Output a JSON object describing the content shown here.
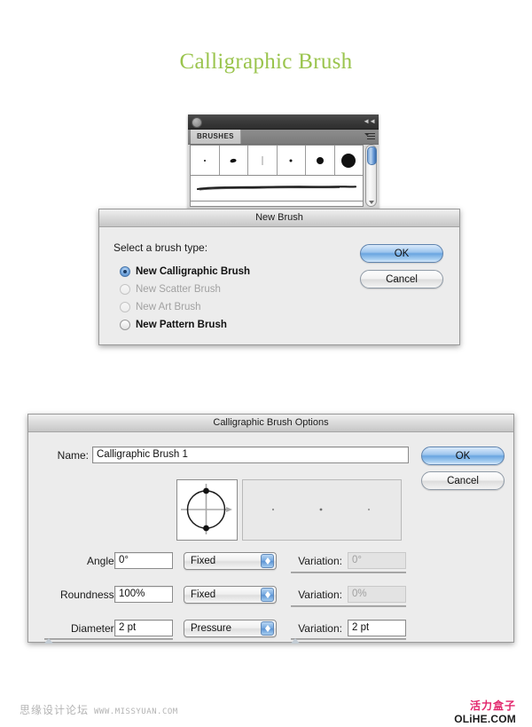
{
  "page": {
    "title": "Calligraphic Brush",
    "title_color": "#9ac44d"
  },
  "brushes_panel": {
    "tab_label": "BRUSHES",
    "close_icon": "close-circle-icon",
    "collapse_icon": "collapse-icon",
    "menu_icon": "panel-menu-icon",
    "swatches": [
      {
        "name": "brush-swatch-1",
        "size": 2
      },
      {
        "name": "brush-swatch-2",
        "size": 5
      },
      {
        "name": "brush-swatch-3",
        "size": 2
      },
      {
        "name": "brush-swatch-4",
        "size": 3
      },
      {
        "name": "brush-swatch-5",
        "size": 8
      },
      {
        "name": "brush-swatch-6",
        "size": 16
      }
    ],
    "stroke_preview_name": "calligraphic-stroke-preview",
    "scrollbar_name": "brushes-scrollbar"
  },
  "new_brush_dialog": {
    "title": "New Brush",
    "prompt": "Select a brush type:",
    "options": [
      {
        "label": "New Calligraphic Brush",
        "selected": true,
        "disabled": false
      },
      {
        "label": "New Scatter Brush",
        "selected": false,
        "disabled": true
      },
      {
        "label": "New Art Brush",
        "selected": false,
        "disabled": true
      },
      {
        "label": "New Pattern Brush",
        "selected": false,
        "disabled": false
      }
    ],
    "ok_label": "OK",
    "cancel_label": "Cancel"
  },
  "brush_options_dialog": {
    "title": "Calligraphic Brush Options",
    "name_label": "Name:",
    "name_value": "Calligraphic Brush 1",
    "ok_label": "OK",
    "cancel_label": "Cancel",
    "rows": [
      {
        "label": "Angle:",
        "value": "0°",
        "mode": "Fixed",
        "variation_label": "Variation:",
        "variation_value": "0°",
        "variation_disabled": true
      },
      {
        "label": "Roundness:",
        "value": "100%",
        "mode": "Fixed",
        "variation_label": "Variation:",
        "variation_value": "0%",
        "variation_disabled": true
      },
      {
        "label": "Diameter:",
        "value": "2 pt",
        "mode": "Pressure",
        "variation_label": "Variation:",
        "variation_value": "2 pt",
        "variation_disabled": false
      }
    ]
  },
  "footer": {
    "left_cn": "思缘设计论坛",
    "left_url": "WWW.MISSYUAN.COM",
    "right_cn": "活力盒子",
    "right_url": "OLiHE.COM"
  }
}
